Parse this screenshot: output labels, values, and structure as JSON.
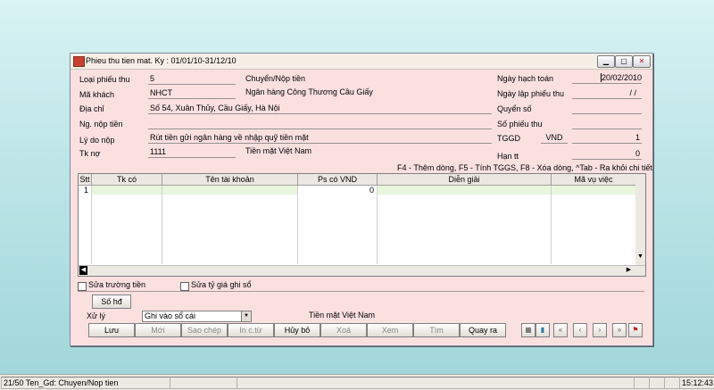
{
  "window": {
    "title": "Phieu thu tien mat. Ky : 01/01/10-31/12/10"
  },
  "form": {
    "loai_phieu_thu": {
      "label": "Loại phiếu thu",
      "value": "5",
      "desc": "Chuyển/Nộp tiền"
    },
    "ma_khach": {
      "label": "Mã khách",
      "value": "NHCT",
      "desc": "Ngân hàng Công Thương Cầu Giấy"
    },
    "dia_chi": {
      "label": "Địa chỉ",
      "value": "Số 54, Xuân Thủy, Cầu Giấy, Hà Nội"
    },
    "ng_nop_tien": {
      "label": "Ng. nộp tiền",
      "value": ""
    },
    "ly_do_nop": {
      "label": "Lý do nộp",
      "value": "Rút tiền gửi ngân hàng về nhập quỹ tiền mặt"
    },
    "tk_no": {
      "label": "Tk nợ",
      "value": "1111",
      "desc": "Tiền mặt Việt Nam"
    },
    "ngay_hach_toan": {
      "label": "Ngày hạch toán",
      "value": "20/02/2010"
    },
    "ngay_lap": {
      "label": "Ngày lập phiếu thu",
      "value": "/  /"
    },
    "quyen_so": {
      "label": "Quyển số",
      "value": ""
    },
    "so_phieu_thu": {
      "label": "Số phiếu thu",
      "value": ""
    },
    "tggd": {
      "label": "TGGD",
      "currency": "VND",
      "value": "1"
    },
    "han_tt": {
      "label": "Hạn tt",
      "value": "0"
    }
  },
  "hint": "F4 - Thêm dòng, F5 - Tính TGGS, F8 - Xóa dòng, ^Tab - Ra khỏi chi tiết",
  "grid": {
    "columns": [
      "Stt",
      "Tk có",
      "Tên tài khoản",
      "Ps có VND",
      "Diễn giải",
      "Mã vụ việc"
    ],
    "rows": [
      {
        "stt": "1",
        "tk_co": "",
        "ten_tk": "",
        "ps_co": "0",
        "dien_giai": "",
        "ma_vu_viec": ""
      }
    ]
  },
  "options": {
    "sua_truong_tien": "Sửa trường tiền",
    "sua_ty_gia": "Sửa tỷ giá ghi sổ"
  },
  "so_hd_label": "Số hđ",
  "xu_ly": {
    "label": "Xử lý",
    "selected": "Ghi vào sổ cái",
    "account_desc": "Tiền mặt Việt Nam"
  },
  "buttons": {
    "luu": "Lưu",
    "moi": "Mới",
    "sao_chep": "Sao chép",
    "in_ct": "In c.từ",
    "huy_bo": "Hủy bỏ",
    "xoa": "Xoá",
    "xem": "Xem",
    "tim": "Tìm",
    "quay_ra": "Quay ra"
  },
  "statusbar": {
    "left": "21/50 Ten_Gd: Chuyen/Nop tien",
    "time": "15:12:43"
  }
}
